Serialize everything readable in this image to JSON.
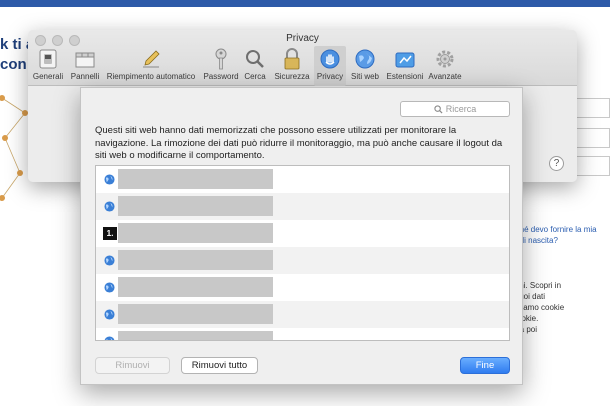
{
  "background": {
    "left_text_1": "k ti a",
    "left_text_2": "con",
    "title_fragment": "..",
    "link_1": "rché devo fornire la mia\na di nascita?",
    "small_text": "ioni. Scopri in\ni tuoi dati\nusiamo cookie\ncookie.\nma poi"
  },
  "prefs_window": {
    "title": "Privacy",
    "toolbar": [
      {
        "label": "Generali",
        "icon": "switch-icon"
      },
      {
        "label": "Pannelli",
        "icon": "tabs-icon"
      },
      {
        "label": "Riempimento automatico",
        "icon": "pencil-icon"
      },
      {
        "label": "Password",
        "icon": "key-icon"
      },
      {
        "label": "Cerca",
        "icon": "magnifier-icon"
      },
      {
        "label": "Sicurezza",
        "icon": "lock-icon"
      },
      {
        "label": "Privacy",
        "icon": "hand-icon"
      },
      {
        "label": "Siti web",
        "icon": "globe-icon"
      },
      {
        "label": "Estensioni",
        "icon": "puzzle-icon"
      },
      {
        "label": "Avanzate",
        "icon": "gear-icon"
      }
    ],
    "selected_tab": "Privacy",
    "help_label": "?"
  },
  "sheet": {
    "search_placeholder": "Ricerca",
    "description": "Questi siti web hanno dati memorizzati che possono essere utilizzati per monitorare la navigazione. La rimozione dei dati può ridurre il monitoraggio, ma può anche causare il logout da siti web o modificarne il comportamento.",
    "rows": [
      {
        "badge": "",
        "sub": ""
      },
      {
        "badge": "",
        "sub": ""
      },
      {
        "badge": "1.",
        "sub": ""
      },
      {
        "badge": "",
        "sub": ""
      },
      {
        "badge": "",
        "sub": ""
      },
      {
        "badge": "",
        "sub": ""
      },
      {
        "badge": "",
        "sub": ""
      }
    ],
    "buttons": {
      "remove": "Rimuovi",
      "remove_all": "Rimuovi tutto",
      "done": "Fine"
    }
  },
  "colors": {
    "accent_blue": "#2f7cf0",
    "selected_tab_bg": "#cfcfcf",
    "redacted_gray": "#c8c8c8"
  }
}
